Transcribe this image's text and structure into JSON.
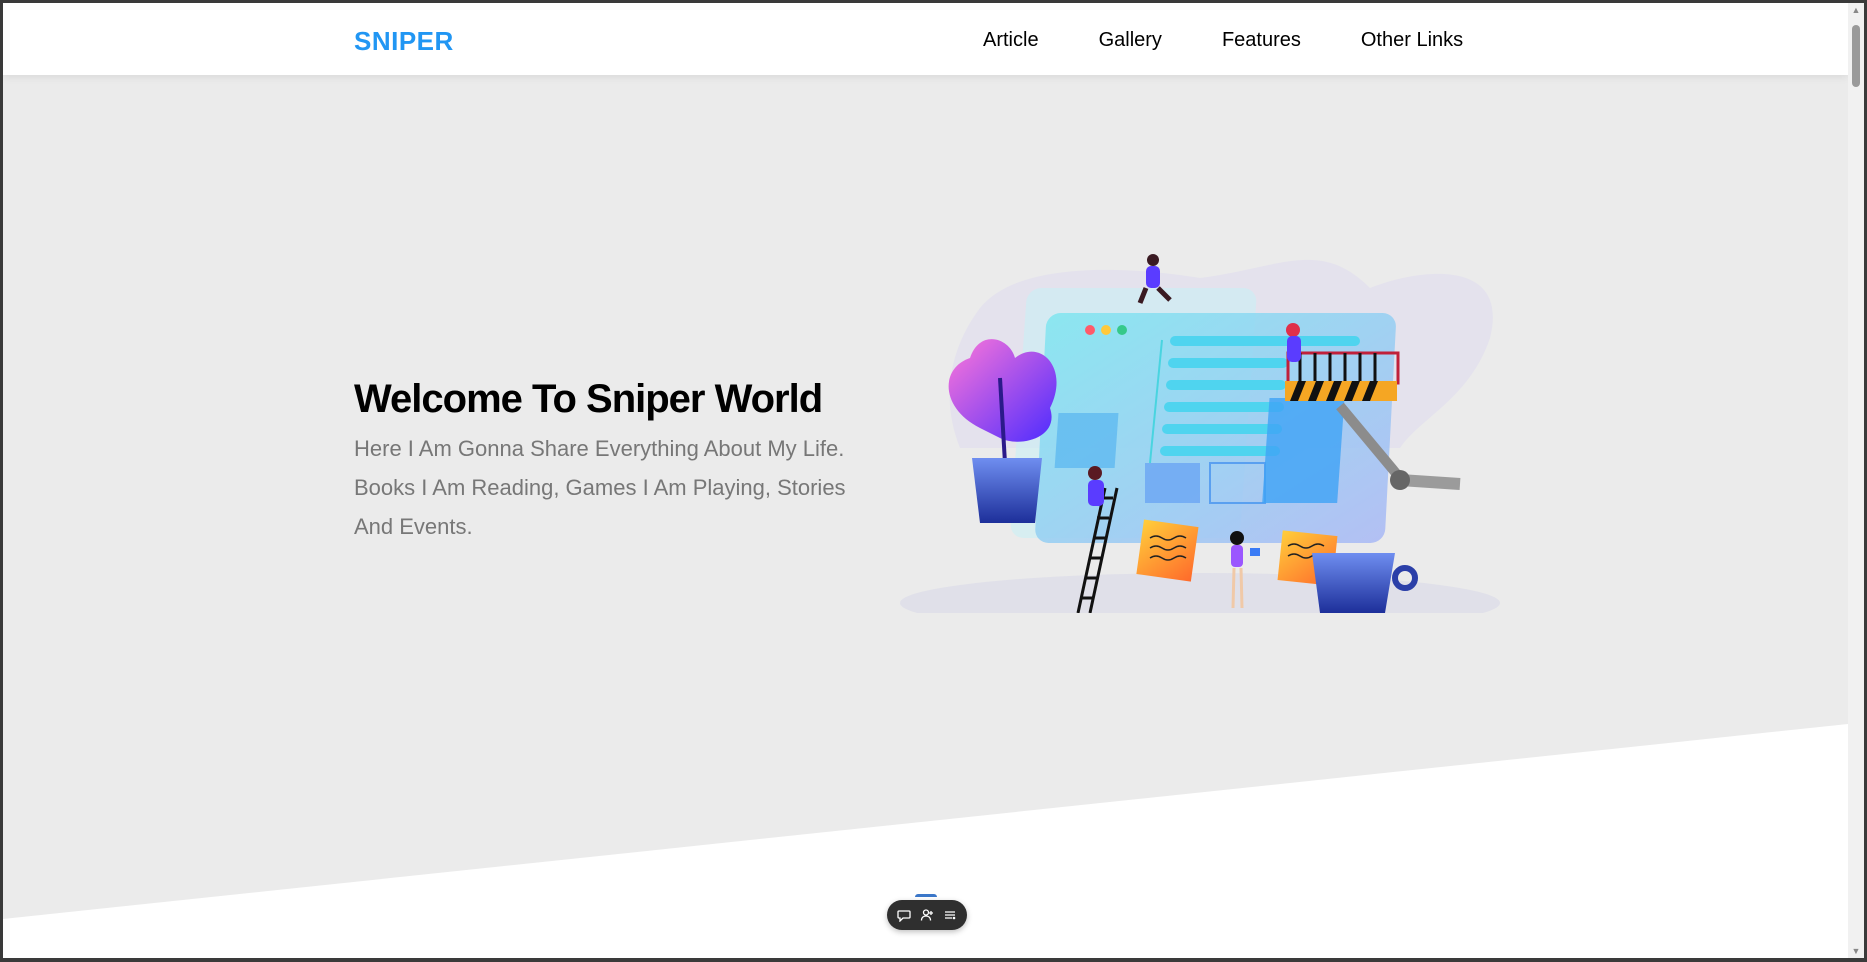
{
  "header": {
    "logo": "SNIPER",
    "nav": [
      {
        "label": "Article"
      },
      {
        "label": "Gallery"
      },
      {
        "label": "Features"
      },
      {
        "label": "Other Links"
      }
    ]
  },
  "hero": {
    "title": "Welcome To Sniper World",
    "description": "Here I Am Gonna Share Everything About My Life. Books I Am Reading, Games I Am Playing, Stories And Events.",
    "illustration_icon": "website-building-illustration"
  },
  "toolbar": {
    "buttons": [
      {
        "icon": "comment-icon"
      },
      {
        "icon": "add-user-icon"
      },
      {
        "icon": "list-settings-icon"
      }
    ]
  },
  "colors": {
    "brand": "#2196f3",
    "hero_background": "#ebebeb",
    "text": "#000000",
    "muted_text": "#777777"
  }
}
